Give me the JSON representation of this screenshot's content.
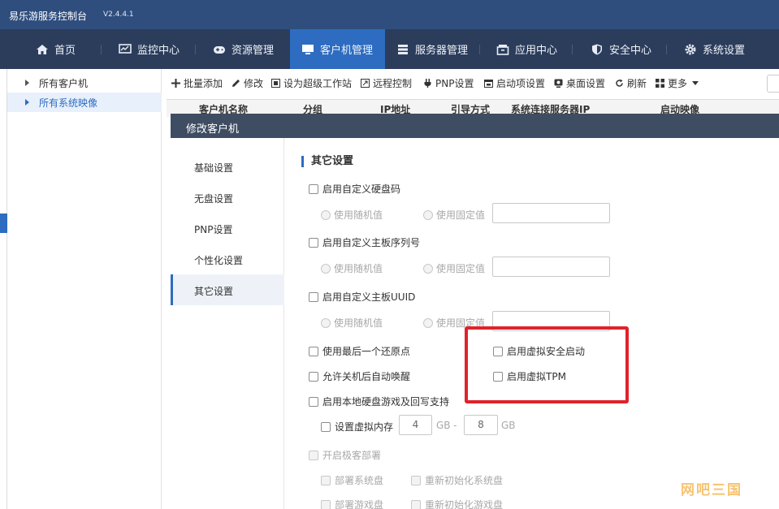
{
  "app": {
    "title": "易乐游服务控制台",
    "version": "V2.4.4.1"
  },
  "nav": {
    "items": [
      {
        "label": "首页",
        "icon": "home-icon"
      },
      {
        "label": "监控中心",
        "icon": "monitor-icon"
      },
      {
        "label": "资源管理",
        "icon": "gamepad-icon"
      },
      {
        "label": "客户机管理",
        "icon": "desktop-icon",
        "active": true
      },
      {
        "label": "服务器管理",
        "icon": "server-icon"
      },
      {
        "label": "应用中心",
        "icon": "app-box-icon"
      },
      {
        "label": "安全中心",
        "icon": "shield-icon"
      },
      {
        "label": "系统设置",
        "icon": "gear-icon"
      }
    ]
  },
  "tree": {
    "items": [
      {
        "label": "所有客户机"
      },
      {
        "label": "所有系统映像",
        "active": true
      }
    ]
  },
  "toolbar": {
    "buttons": [
      {
        "label": "批量添加",
        "icon": "plus-icon"
      },
      {
        "label": "修改",
        "icon": "pencil-icon"
      },
      {
        "label": "设为超级工作站",
        "icon": "workstation-icon"
      },
      {
        "label": "远程控制",
        "icon": "remote-icon"
      },
      {
        "label": "PNP设置",
        "icon": "pnp-icon"
      },
      {
        "label": "启动项设置",
        "icon": "boot-icon"
      },
      {
        "label": "桌面设置",
        "icon": "desktop-settings-icon"
      },
      {
        "label": "刷新",
        "icon": "refresh-icon"
      },
      {
        "label": "更多",
        "icon": "grid-icon"
      }
    ]
  },
  "table": {
    "columns": [
      "客户机名称",
      "分组",
      "IP地址",
      "引导方式",
      "系统连接服务器IP",
      "启动映像"
    ]
  },
  "modal": {
    "title": "修改客户机",
    "nav": [
      "基础设置",
      "无盘设置",
      "PNP设置",
      "个性化设置",
      "其它设置"
    ],
    "active_nav": "其它设置",
    "section_title": "其它设置",
    "custom_disk_code": {
      "label": "启用自定义硬盘码",
      "random": "使用随机值",
      "fixed": "使用固定值",
      "value": ""
    },
    "custom_board_serial": {
      "label": "启用自定义主板序列号",
      "random": "使用随机值",
      "fixed": "使用固定值",
      "value": ""
    },
    "custom_board_uuid": {
      "label": "启用自定义主板UUID",
      "random": "使用随机值",
      "fixed": "使用固定值",
      "value": ""
    },
    "use_last_restore_point": "使用最后一个还原点",
    "allow_wake_after_shutdown": "允许关机后自动唤醒",
    "local_disk_game_writeback": "启用本地硬盘游戏及回写支持",
    "virtual_memory": {
      "label": "设置虚拟内存",
      "min": "4",
      "max": "8",
      "unit": "GB",
      "separator": "-"
    },
    "fast_deploy": {
      "label": "开启极客部署",
      "deploy_system": "部署系统盘",
      "reinit_system": "重新初始化系统盘",
      "deploy_game": "部署游戏盘",
      "reinit_game": "重新初始化游戏盘"
    },
    "virtual_secure_boot": "启用虚拟安全启动",
    "virtual_tpm": "启用虚拟TPM"
  },
  "watermark": "网吧三国",
  "colors": {
    "accent": "#2d6cc0",
    "highlight": "#e0222b",
    "navbar": "#2c3d5c",
    "modal_header": "#3f4d63"
  }
}
